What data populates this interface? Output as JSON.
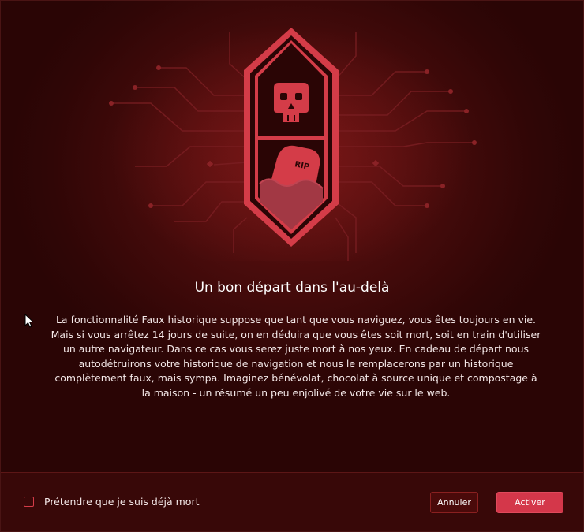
{
  "dialog": {
    "title": "Un bon départ dans l'au-delà",
    "body": "La fonctionnalité Faux historique suppose que tant que vous naviguez, vous êtes toujours en vie. Mais si vous arrêtez 14 jours de suite, on en déduira que vous êtes soit mort, soit en train d'utiliser un autre navigateur. Dans ce cas vous serez juste mort à nos yeux. En cadeau de départ nous autodétruirons votre historique de navigation et nous le remplacerons par un historique complètement faux, mais sympa. Imaginez bénévolat, chocolat à source unique et compostage à la maison - un résumé un peu enjolivé de votre vie sur le web.",
    "illustration": {
      "icons": [
        "skull-icon",
        "tombstone-icon"
      ],
      "tombstone_text": "RIP"
    }
  },
  "footer": {
    "checkbox_label": "Prétendre que je suis déjà mort",
    "checkbox_checked": false,
    "cancel_label": "Annuler",
    "confirm_label": "Activer"
  },
  "colors": {
    "accent": "#d4374a",
    "background": "#4a0c0c",
    "footer_background": "#380808"
  }
}
